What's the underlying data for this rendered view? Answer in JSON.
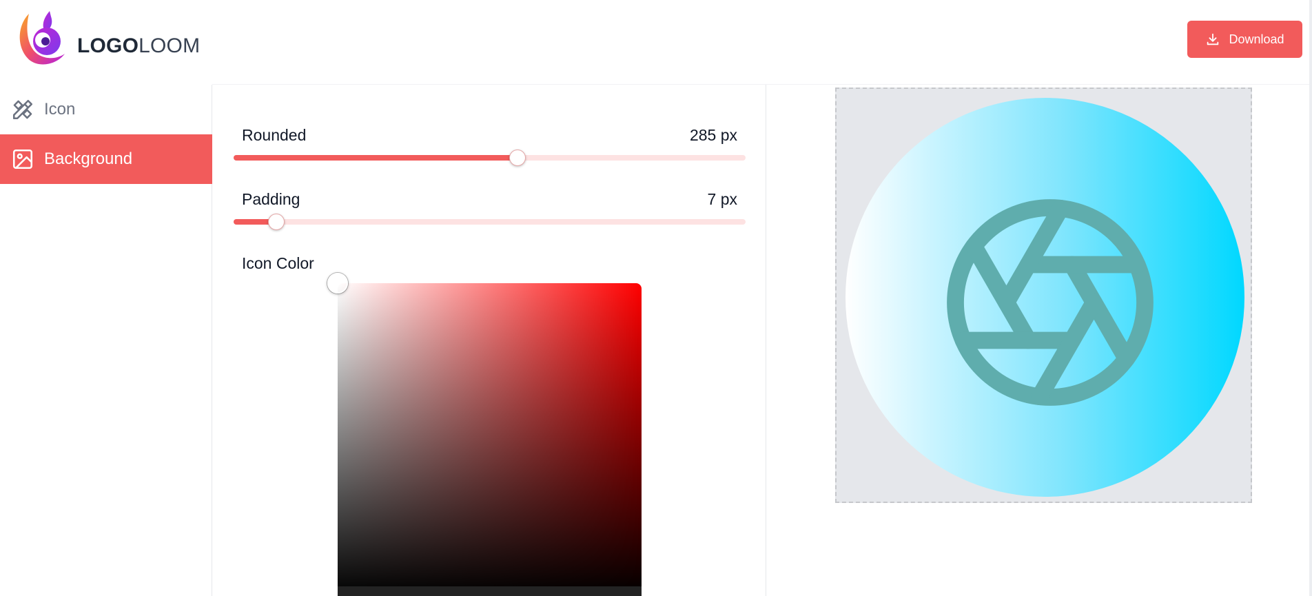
{
  "brand": {
    "bold": "LOGO",
    "light": "LOOM"
  },
  "header": {
    "download_label": "Download"
  },
  "sidebar": {
    "items": [
      {
        "label": "Icon",
        "icon": "pencil-ruler-icon",
        "active": false
      },
      {
        "label": "Background",
        "icon": "image-icon",
        "active": true
      }
    ]
  },
  "controls": {
    "rounded": {
      "label": "Rounded",
      "value": "285 px",
      "fraction": 0.555
    },
    "padding": {
      "label": "Padding",
      "value": "7 px",
      "fraction": 0.083
    },
    "icon_color": {
      "label": "Icon Color"
    }
  },
  "preview": {
    "icon": "aperture-icon",
    "icon_color": "#5fadad",
    "gradient": [
      "#ffffff",
      "#00d8ff"
    ]
  },
  "colors": {
    "accent": "#f25b5b",
    "accent_light": "#fde2e2"
  }
}
